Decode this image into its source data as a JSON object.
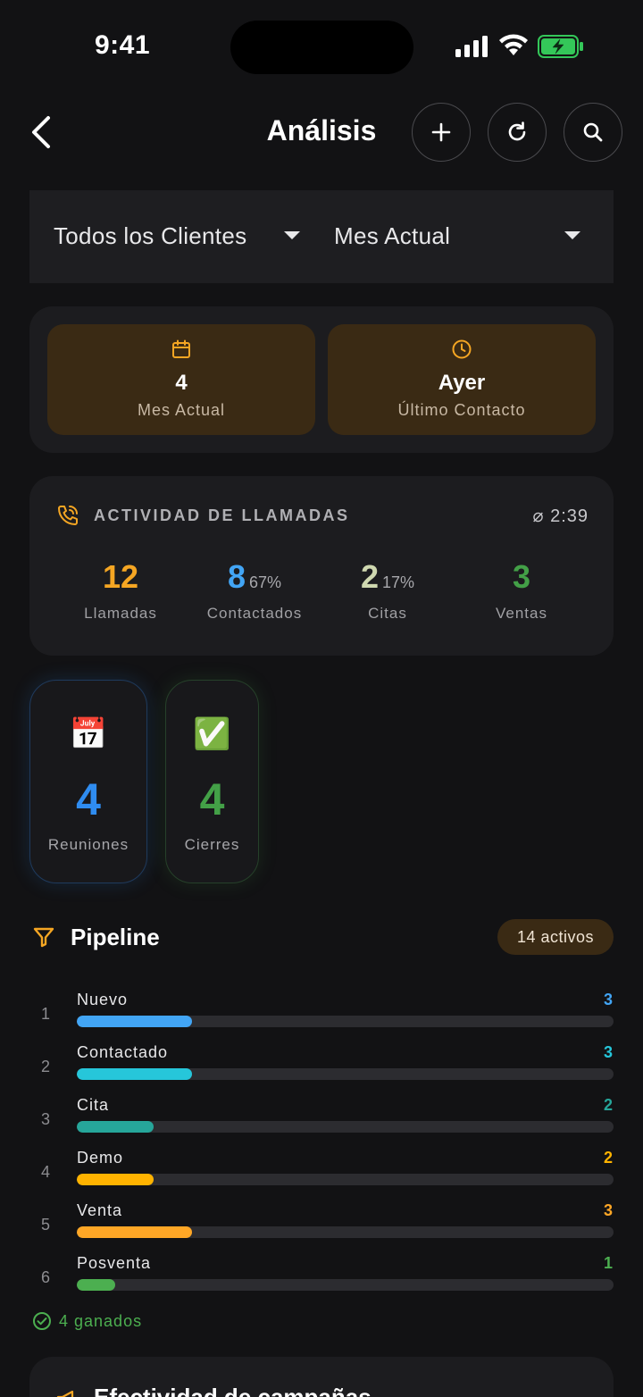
{
  "status_bar": {
    "time": "9:41",
    "battery_color": "#34c759"
  },
  "header": {
    "title": "Análisis"
  },
  "filters": {
    "client": "Todos los Clientes",
    "period": "Mes Actual"
  },
  "summary": [
    {
      "icon": "calendar-icon",
      "value": "4",
      "label": "Mes Actual"
    },
    {
      "icon": "clock-icon",
      "value": "Ayer",
      "label": "Último Contacto"
    }
  ],
  "calls": {
    "title": "ACTIVIDAD DE LLAMADAS",
    "avg": "⌀ 2:39",
    "stats": [
      {
        "value": "12",
        "pct": "",
        "label": "Llamadas",
        "color": "#f5a623"
      },
      {
        "value": "8",
        "pct": "67%",
        "label": "Contactados",
        "color": "#42a5f5"
      },
      {
        "value": "2",
        "pct": "17%",
        "label": "Citas",
        "color": "#cfd8b0"
      },
      {
        "value": "3",
        "pct": "",
        "label": "Ventas",
        "color": "#43a047"
      }
    ]
  },
  "highlights": [
    {
      "emoji": "📅",
      "value": "4",
      "label": "Reuniones",
      "color": "#2f8cf0"
    },
    {
      "emoji": "✅",
      "value": "4",
      "label": "Cierres",
      "color": "#43a047"
    }
  ],
  "pipeline": {
    "title": "Pipeline",
    "active_badge": "14 activos",
    "max": 14,
    "stages": [
      {
        "index": "1",
        "name": "Nuevo",
        "count": 3,
        "color": "#42a5f5",
        "count_color": "#42a5f5"
      },
      {
        "index": "2",
        "name": "Contactado",
        "count": 3,
        "color": "#26c6da",
        "count_color": "#26c6da"
      },
      {
        "index": "3",
        "name": "Cita",
        "count": 2,
        "color": "#26a69a",
        "count_color": "#26a69a"
      },
      {
        "index": "4",
        "name": "Demo",
        "count": 2,
        "color": "#ffb300",
        "count_color": "#ffb300"
      },
      {
        "index": "5",
        "name": "Venta",
        "count": 3,
        "color": "#ffa726",
        "count_color": "#ffa726"
      },
      {
        "index": "6",
        "name": "Posventa",
        "count": 1,
        "color": "#4caf50",
        "count_color": "#4caf50"
      }
    ],
    "won": "4 ganados"
  },
  "campaigns": {
    "title": "Efectividad de campañas"
  }
}
